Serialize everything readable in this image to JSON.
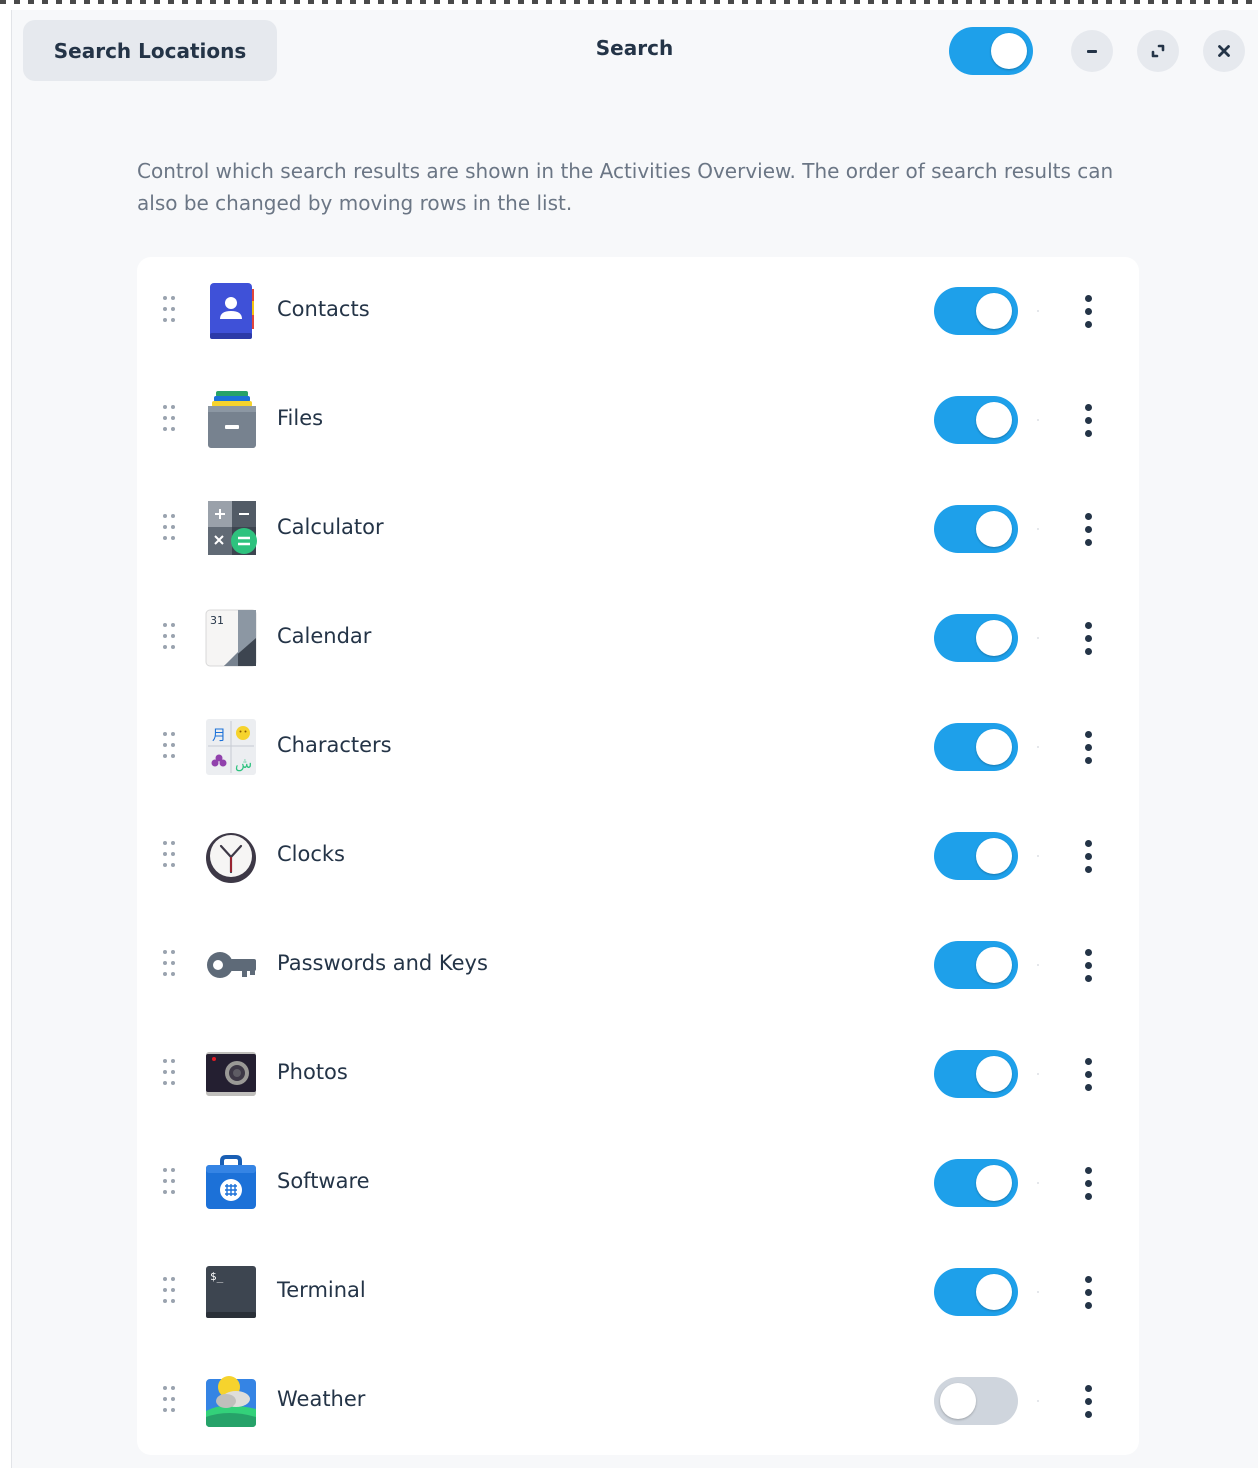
{
  "header": {
    "left_button_label": "Search Locations",
    "title": "Search",
    "search_enabled": true
  },
  "window_controls": {
    "minimize_icon": "minimize-icon",
    "maximize_icon": "maximize-icon",
    "close_icon": "close-icon"
  },
  "description": "Control which search results are shown in the Activities Overview. The order of search results can also be changed by moving rows in the list.",
  "colors": {
    "accent": "#1ea0ea",
    "switch_off": "#cfd5dd",
    "text": "#243447",
    "muted_text": "#6b7685"
  },
  "providers": [
    {
      "label": "Contacts",
      "icon": "contacts-icon",
      "enabled": true
    },
    {
      "label": "Files",
      "icon": "files-icon",
      "enabled": true
    },
    {
      "label": "Calculator",
      "icon": "calculator-icon",
      "enabled": true
    },
    {
      "label": "Calendar",
      "icon": "calendar-icon",
      "enabled": true,
      "icon_text": "31"
    },
    {
      "label": "Characters",
      "icon": "characters-icon",
      "enabled": true
    },
    {
      "label": "Clocks",
      "icon": "clocks-icon",
      "enabled": true
    },
    {
      "label": "Passwords and Keys",
      "icon": "key-icon",
      "enabled": true
    },
    {
      "label": "Photos",
      "icon": "camera-icon",
      "enabled": true
    },
    {
      "label": "Software",
      "icon": "software-icon",
      "enabled": true
    },
    {
      "label": "Terminal",
      "icon": "terminal-icon",
      "enabled": true,
      "icon_text": "$_"
    },
    {
      "label": "Weather",
      "icon": "weather-icon",
      "enabled": false
    }
  ]
}
